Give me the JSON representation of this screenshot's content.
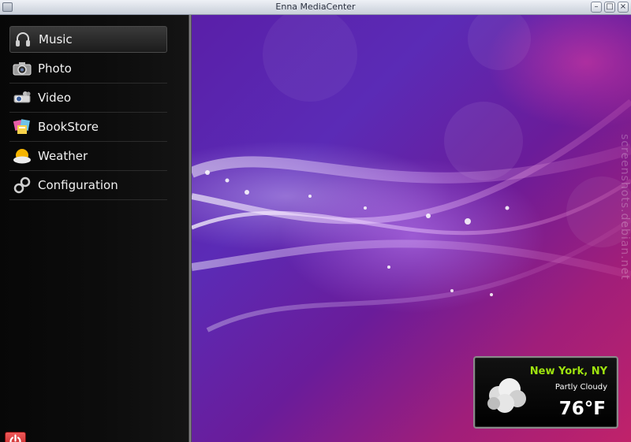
{
  "window": {
    "title": "Enna MediaCenter",
    "min_label": "–",
    "max_label": "□",
    "close_label": "×"
  },
  "menu": {
    "items": [
      {
        "label": "Music",
        "icon": "headphones-icon",
        "selected": true
      },
      {
        "label": "Photo",
        "icon": "camera-icon",
        "selected": false
      },
      {
        "label": "Video",
        "icon": "projector-icon",
        "selected": false
      },
      {
        "label": "BookStore",
        "icon": "books-icon",
        "selected": false
      },
      {
        "label": "Weather",
        "icon": "sun-cloud-icon",
        "selected": false
      },
      {
        "label": "Configuration",
        "icon": "gears-icon",
        "selected": false
      }
    ]
  },
  "weather": {
    "city": "New York, NY",
    "condition": "Partly Cloudy",
    "temperature": "76°F",
    "icon": "cloud-icon"
  },
  "watermark": "screenshots.debian.net",
  "colors": {
    "accent_green": "#9fe30f",
    "power_red": "#d42a2a"
  }
}
